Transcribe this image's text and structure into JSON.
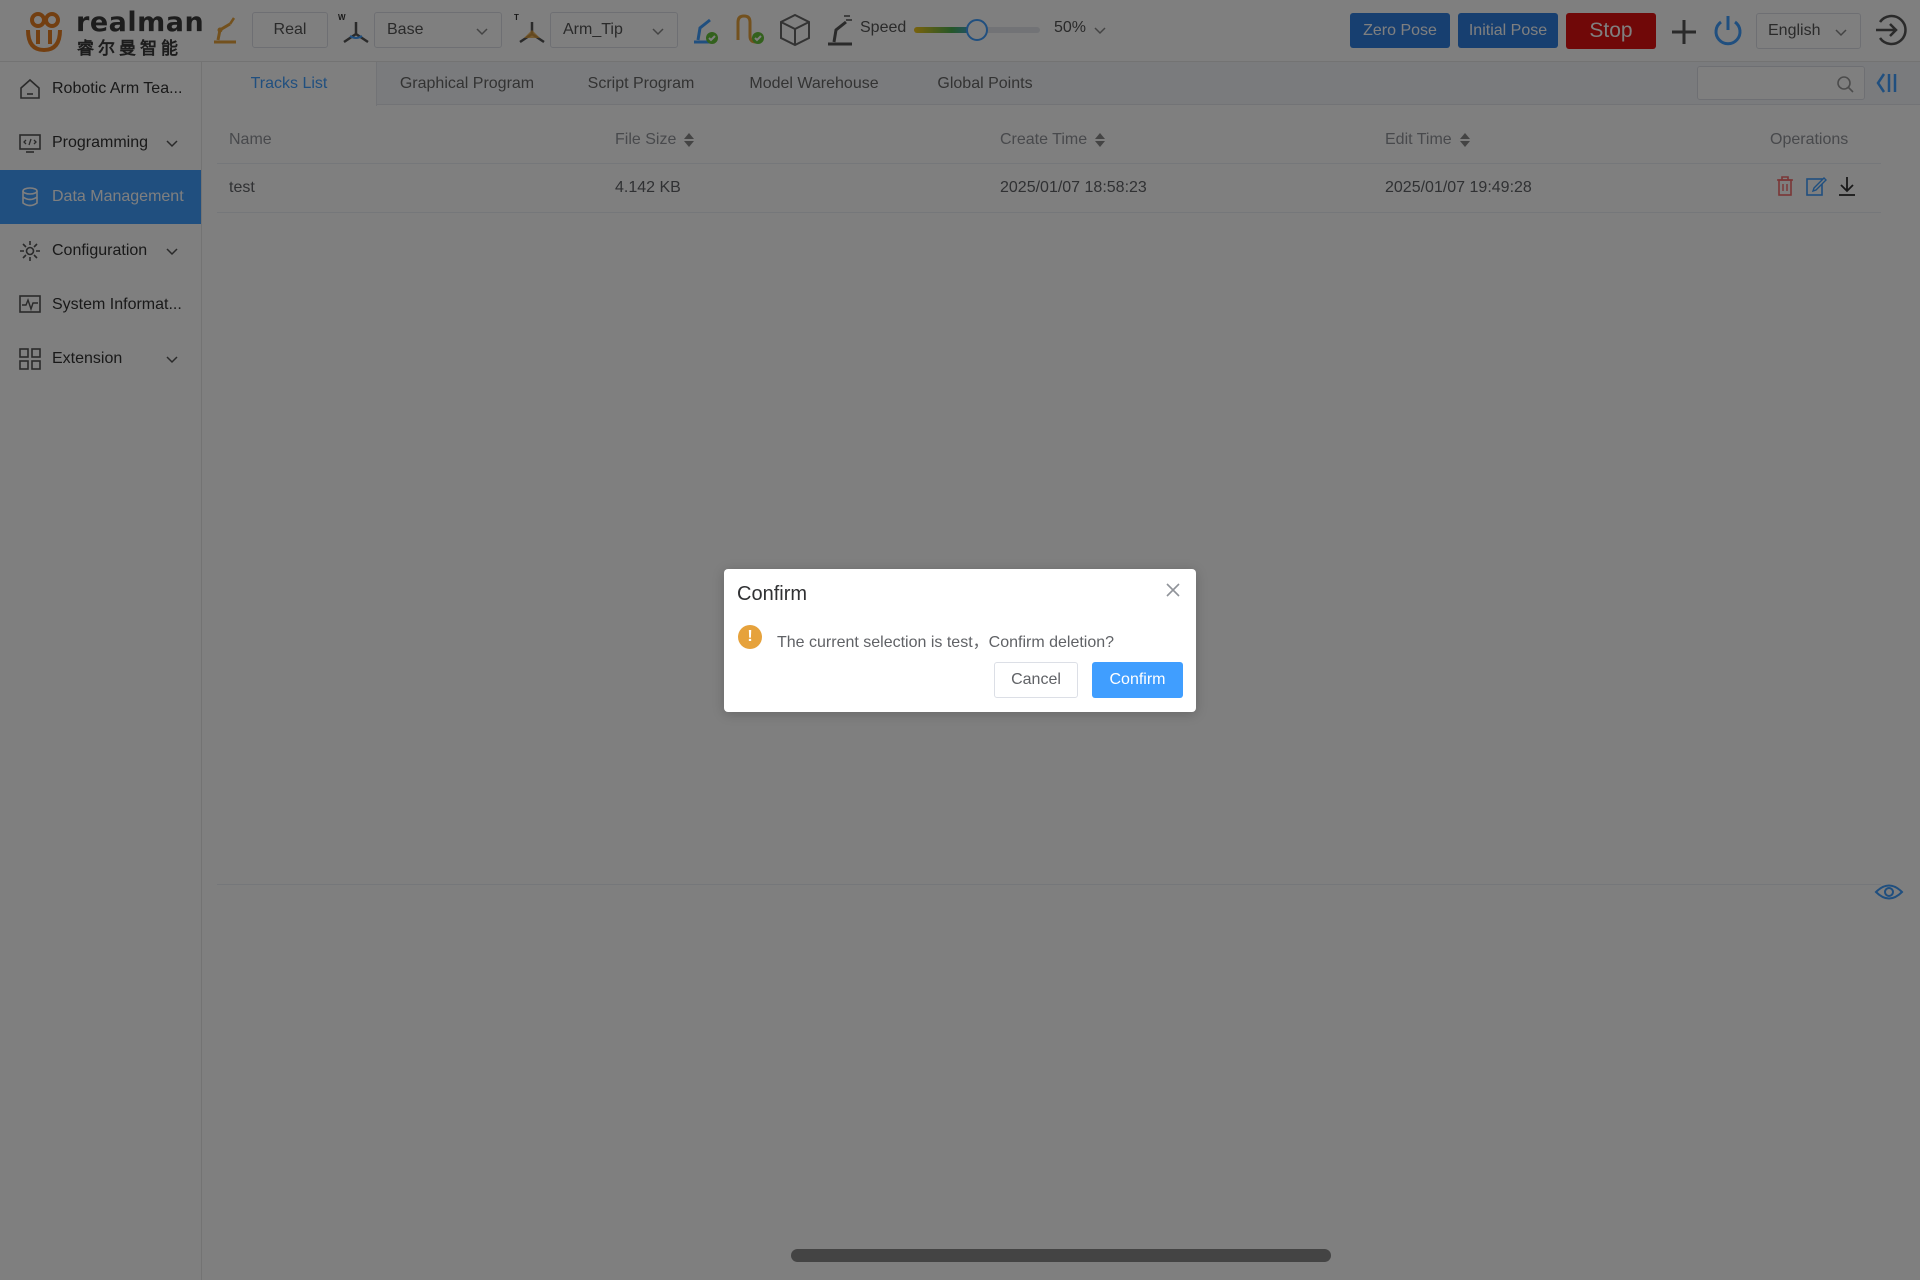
{
  "logo": {
    "en": "realman",
    "cn": "睿尔曼智能"
  },
  "toolbar": {
    "mode_label": "Real",
    "work_frame_sup": "W",
    "work_frame_value": "Base",
    "tool_frame_sup": "T",
    "tool_frame_value": "Arm_Tip",
    "speed_label": "Speed",
    "speed_value": "50%",
    "speed_fraction": 0.5,
    "zero_pose_label": "Zero Pose",
    "initial_pose_label": "Initial Pose",
    "stop_label": "Stop",
    "language": "English"
  },
  "colors": {
    "accent": "#409eff",
    "pose_button": "#2f7fe0",
    "stop": "#e01010",
    "warning": "#e6a23c",
    "danger_icon": "#f56c6c"
  },
  "sidebar": {
    "items": [
      {
        "label": "Robotic Arm Tea...",
        "icon": "home-icon"
      },
      {
        "label": "Programming",
        "icon": "code-monitor-icon"
      },
      {
        "label": "Data Management",
        "icon": "database-icon"
      },
      {
        "label": "Configuration",
        "icon": "gear-icon"
      },
      {
        "label": "System Informat...",
        "icon": "pulse-monitor-icon"
      },
      {
        "label": "Extension",
        "icon": "grid-apps-icon"
      }
    ]
  },
  "tabs": [
    "Tracks List",
    "Graphical Program",
    "Script Program",
    "Model Warehouse",
    "Global Points"
  ],
  "table": {
    "columns": [
      "Name",
      "File Size",
      "Create Time",
      "Edit Time",
      "Operations"
    ],
    "rows": [
      {
        "name": "test",
        "size": "4.142 KB",
        "created": "2025/01/07 18:58:23",
        "edited": "2025/01/07 19:49:28"
      }
    ]
  },
  "dialog": {
    "title": "Confirm",
    "message": "The current selection is test，Confirm deletion?",
    "cancel_label": "Cancel",
    "confirm_label": "Confirm"
  }
}
